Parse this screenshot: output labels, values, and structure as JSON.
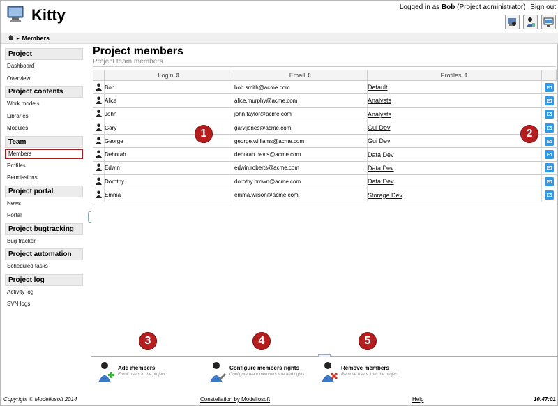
{
  "app": {
    "title": "Kitty"
  },
  "session": {
    "logged_in_prefix": "Logged in as",
    "user": "Bob",
    "role": "(Project administrator)",
    "signout": "Sign out"
  },
  "breadcrumb": {
    "current": "Members"
  },
  "sidebar": {
    "sections": [
      {
        "title": "Project",
        "items": [
          "Dashboard",
          "Overview"
        ]
      },
      {
        "title": "Project contents",
        "items": [
          "Work models",
          "Libraries",
          "Modules"
        ]
      },
      {
        "title": "Team",
        "items": [
          "Members",
          "Profiles",
          "Permissions"
        ]
      },
      {
        "title": "Project portal",
        "items": [
          "News",
          "Portal"
        ]
      },
      {
        "title": "Project bugtracking",
        "items": [
          "Bug tracker"
        ]
      },
      {
        "title": "Project automation",
        "items": [
          "Scheduled tasks"
        ]
      },
      {
        "title": "Project log",
        "items": [
          "Activity log",
          "SVN logs"
        ]
      }
    ],
    "active_item": "Members"
  },
  "main": {
    "title": "Project members",
    "subtitle": "Project team members",
    "columns": {
      "login": "Login",
      "email": "Email",
      "profiles": "Profiles"
    },
    "rows": [
      {
        "login": "Bob",
        "email": "bob.smith@acme.com",
        "profile": "Default"
      },
      {
        "login": "Alice",
        "email": "alice.murphy@acme.com",
        "profile": "Analysts"
      },
      {
        "login": "John",
        "email": "john.taylor@acme.com",
        "profile": "Analysts"
      },
      {
        "login": "Gary",
        "email": "gary.jones@acme.com",
        "profile": "Gui Dev"
      },
      {
        "login": "George",
        "email": "george.williams@acme.com",
        "profile": "Gui Dev"
      },
      {
        "login": "Deborah",
        "email": "deborah.devis@acme.com",
        "profile": "Data Dev"
      },
      {
        "login": "Edwin",
        "email": "edwin.roberts@acme.com",
        "profile": "Data Dev"
      },
      {
        "login": "Dorothy",
        "email": "dorothy.brown@acme.com",
        "profile": "Data Dev"
      },
      {
        "login": "Emma",
        "email": "emma.wilson@acme.com",
        "profile": "Storage Dev"
      }
    ]
  },
  "markers": [
    "1",
    "2",
    "3",
    "4",
    "5"
  ],
  "actions": [
    {
      "name": "Add members",
      "desc": "Enroll users in the project"
    },
    {
      "name": "Configure members rights",
      "desc": "Configure team members role and rights"
    },
    {
      "name": "Remove members",
      "desc": "Remove users from the project"
    }
  ],
  "footer": {
    "copyright": "Copyright © Modeliosoft 2014",
    "constellation": "Constellation by Modeliosoft",
    "help": "Help",
    "clock": "10:47:01"
  },
  "colors": {
    "marker": "#b51e1e",
    "mail_button": "#2d9ae6",
    "active_outline": "#a81c1c"
  }
}
